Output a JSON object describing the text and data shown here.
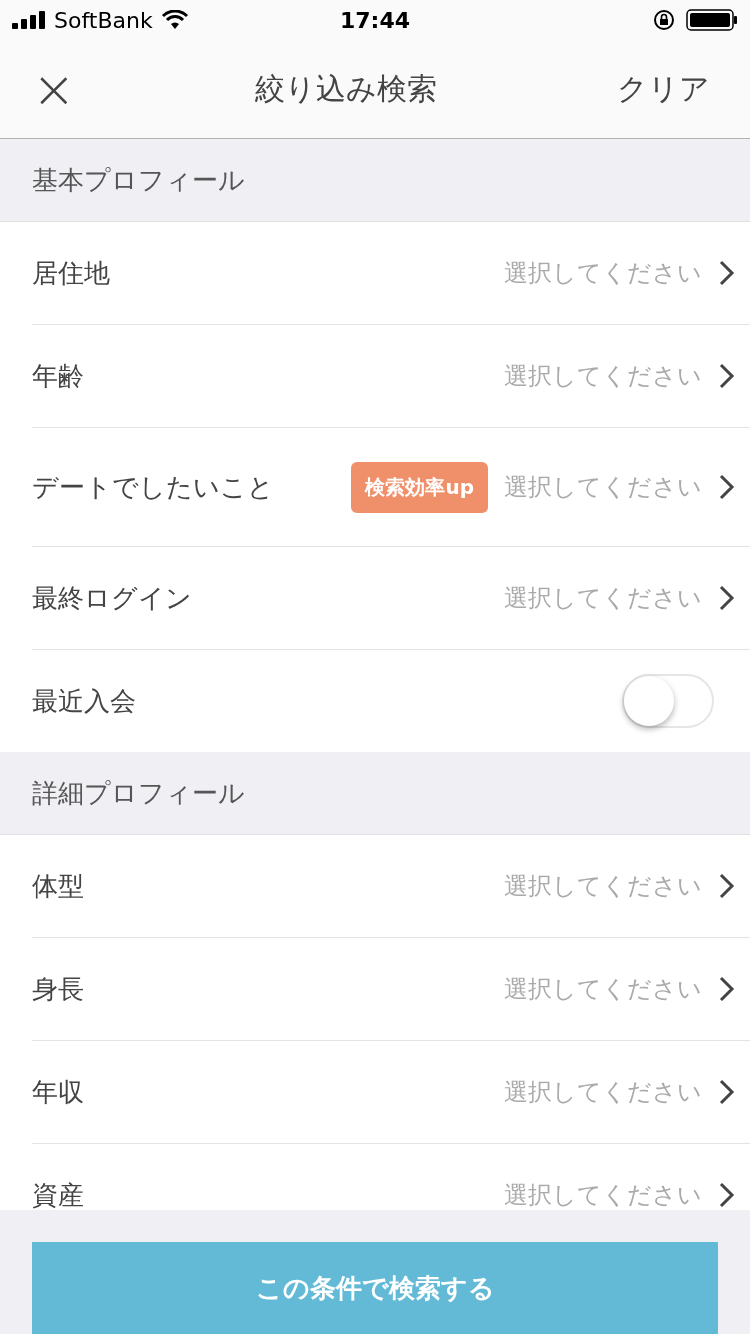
{
  "status_bar": {
    "carrier": "SoftBank",
    "time": "17:44"
  },
  "nav": {
    "close": "×",
    "title": "絞り込み検索",
    "action": "クリア"
  },
  "sections": [
    {
      "title": "基本プロフィール",
      "rows": [
        {
          "kind": "select",
          "label": "居住地",
          "value": "選択してください"
        },
        {
          "kind": "select",
          "label": "年齢",
          "value": "選択してください"
        },
        {
          "kind": "select",
          "label": "デートでしたいこと",
          "badge": "検索効率up",
          "value": "選択してください"
        },
        {
          "kind": "select",
          "label": "最終ログイン",
          "value": "選択してください"
        },
        {
          "kind": "toggle",
          "label": "最近入会",
          "on": false
        }
      ]
    },
    {
      "title": "詳細プロフィール",
      "rows": [
        {
          "kind": "select",
          "label": "体型",
          "value": "選択してください"
        },
        {
          "kind": "select",
          "label": "身長",
          "value": "選択してください"
        },
        {
          "kind": "select",
          "label": "年収",
          "value": "選択してください"
        },
        {
          "kind": "select",
          "label": "資産",
          "value": "選択してください"
        }
      ]
    }
  ],
  "search_button": "この条件で検索する"
}
